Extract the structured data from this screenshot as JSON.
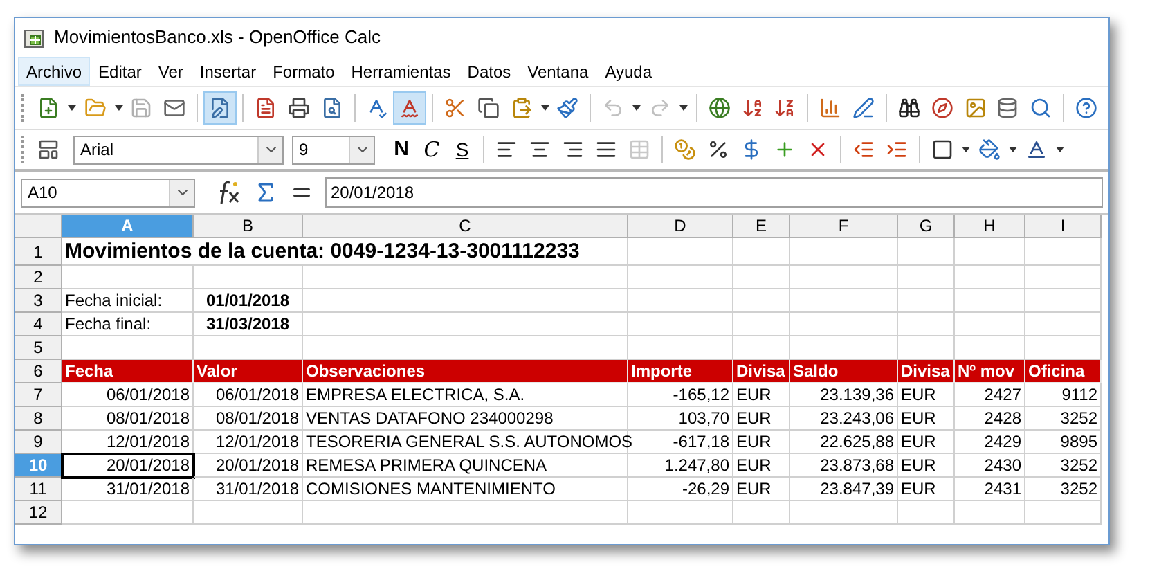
{
  "window": {
    "title": "MovimientosBanco.xls - OpenOffice Calc"
  },
  "menu": [
    {
      "label": "Archivo",
      "selected": true
    },
    {
      "label": "Editar",
      "selected": false
    },
    {
      "label": "Ver",
      "selected": false
    },
    {
      "label": "Insertar",
      "selected": false
    },
    {
      "label": "Formato",
      "selected": false
    },
    {
      "label": "Herramientas",
      "selected": false
    },
    {
      "label": "Datos",
      "selected": false
    },
    {
      "label": "Ventana",
      "selected": false
    },
    {
      "label": "Ayuda",
      "selected": false
    }
  ],
  "toolbar": {
    "edit_mode_on": true,
    "auto_spellcheck_on": true,
    "undo_disabled": true,
    "redo_disabled": true
  },
  "format_bar": {
    "font": "Arial",
    "size": "9",
    "bold_label": "N",
    "italic_label": "C",
    "underline_label": "S"
  },
  "formula_bar": {
    "name_box": "A10",
    "value": "20/01/2018"
  },
  "columns": [
    {
      "label": "A",
      "selected": true
    },
    {
      "label": "B",
      "selected": false
    },
    {
      "label": "C",
      "selected": false
    },
    {
      "label": "D",
      "selected": false
    },
    {
      "label": "E",
      "selected": false
    },
    {
      "label": "F",
      "selected": false
    },
    {
      "label": "G",
      "selected": false
    },
    {
      "label": "H",
      "selected": false
    },
    {
      "label": "I",
      "selected": false
    }
  ],
  "rows": [
    {
      "number": "1",
      "selected": false,
      "kind": "title",
      "text": "Movimientos de la cuenta: 0049-1234-13-3001112233"
    },
    {
      "number": "2",
      "selected": false,
      "kind": "blank"
    },
    {
      "number": "3",
      "selected": false,
      "kind": "field",
      "label": "Fecha inicial:",
      "value": "01/01/2018"
    },
    {
      "number": "4",
      "selected": false,
      "kind": "field",
      "label": "Fecha final:",
      "value": "31/03/2018"
    },
    {
      "number": "5",
      "selected": false,
      "kind": "blank"
    },
    {
      "number": "6",
      "selected": false,
      "kind": "header",
      "cells": [
        "Fecha",
        "Valor",
        "Observaciones",
        "Importe",
        "Divisa",
        "Saldo",
        "Divisa",
        "Nº mov",
        "Oficina"
      ]
    },
    {
      "number": "7",
      "selected": false,
      "kind": "data",
      "cells": [
        "06/01/2018",
        "06/01/2018",
        "EMPRESA ELECTRICA, S.A.",
        "-165,12",
        "EUR",
        "23.139,36",
        "EUR",
        "2427",
        "9112"
      ]
    },
    {
      "number": "8",
      "selected": false,
      "kind": "data",
      "cells": [
        "08/01/2018",
        "08/01/2018",
        "VENTAS DATAFONO 234000298",
        "103,70",
        "EUR",
        "23.243,06",
        "EUR",
        "2428",
        "3252"
      ]
    },
    {
      "number": "9",
      "selected": false,
      "kind": "data",
      "cells": [
        "12/01/2018",
        "12/01/2018",
        "TESORERIA GENERAL S.S. AUTONOMOS",
        "-617,18",
        "EUR",
        "22.625,88",
        "EUR",
        "2429",
        "9895"
      ]
    },
    {
      "number": "10",
      "selected": true,
      "kind": "data",
      "cells": [
        "20/01/2018",
        "20/01/2018",
        "REMESA PRIMERA QUINCENA",
        "1.247,80",
        "EUR",
        "23.873,68",
        "EUR",
        "2430",
        "3252"
      ]
    },
    {
      "number": "11",
      "selected": false,
      "kind": "data",
      "cells": [
        "31/01/2018",
        "31/01/2018",
        "COMISIONES MANTENIMIENTO",
        "-26,29",
        "EUR",
        "23.847,39",
        "EUR",
        "2431",
        "3252"
      ]
    },
    {
      "number": "12",
      "selected": false,
      "kind": "blank"
    }
  ]
}
